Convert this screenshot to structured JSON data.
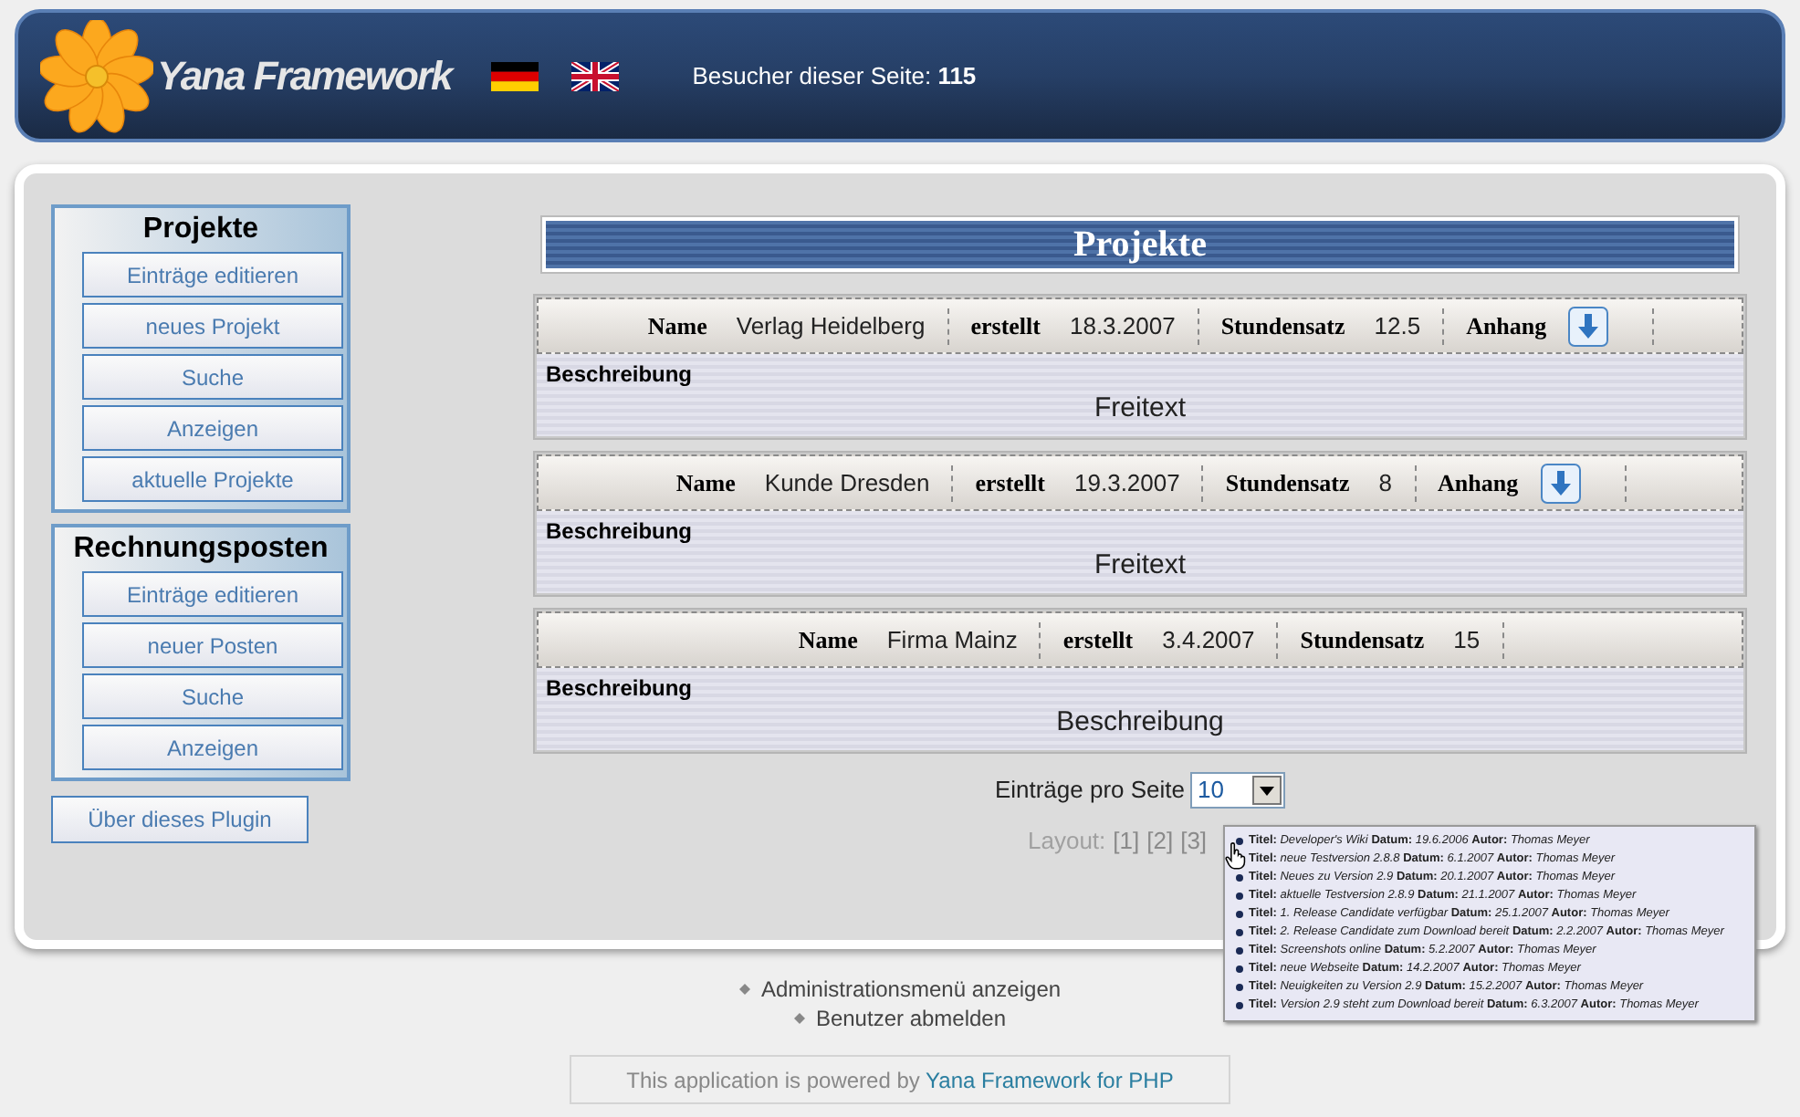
{
  "header": {
    "logo": "Yana Framework",
    "visitors_label": "Besucher dieser Seite:",
    "visitors_count": "115"
  },
  "sidebar": [
    {
      "title": "Projekte",
      "items": [
        "Einträge editieren",
        "neues Projekt",
        "Suche",
        "Anzeigen",
        "aktuelle Projekte"
      ]
    },
    {
      "title": "Rechnungsposten",
      "items": [
        "Einträge editieren",
        "neuer Posten",
        "Suche",
        "Anzeigen"
      ]
    }
  ],
  "plugin_button": "Über dieses Plugin",
  "content": {
    "title": "Projekte",
    "records": [
      {
        "fields": [
          {
            "kind": "text",
            "label": "Name",
            "value": "Verlag Heidelberg"
          },
          {
            "kind": "text",
            "label": "erstellt",
            "value": "18.3.2007"
          },
          {
            "kind": "text",
            "label": "Stundensatz",
            "value": "12.5"
          },
          {
            "kind": "attachment",
            "label": "Anhang"
          }
        ],
        "description_label": "Beschreibung",
        "description": "Freitext"
      },
      {
        "fields": [
          {
            "kind": "text",
            "label": "Name",
            "value": "Kunde Dresden"
          },
          {
            "kind": "text",
            "label": "erstellt",
            "value": "19.3.2007"
          },
          {
            "kind": "text",
            "label": "Stundensatz",
            "value": "8"
          },
          {
            "kind": "attachment",
            "label": "Anhang"
          }
        ],
        "description_label": "Beschreibung",
        "description": "Freitext"
      },
      {
        "fields": [
          {
            "kind": "text",
            "label": "Name",
            "value": "Firma Mainz"
          },
          {
            "kind": "text",
            "label": "erstellt",
            "value": "3.4.2007"
          },
          {
            "kind": "text",
            "label": "Stundensatz",
            "value": "15"
          }
        ],
        "description_label": "Beschreibung",
        "description": "Beschreibung"
      }
    ],
    "per_page_label": "Einträge pro Seite",
    "per_page_value": "10",
    "layout_label": "Layout:",
    "layouts": [
      "[1]",
      "[2]",
      "[3]"
    ]
  },
  "tooltip": {
    "items": [
      "**Titel:** *Developer's Wiki* **Datum:** *19.6.2006* **Autor:** *Thomas Meyer*",
      "**Titel:** *neue Testversion 2.8.8* **Datum:** *6.1.2007* **Autor:** *Thomas Meyer*",
      "**Titel:** *Neues zu Version 2.9* **Datum:** *20.1.2007* **Autor:** *Thomas Meyer*",
      "**Titel:** *aktuelle Testversion 2.8.9* **Datum:** *21.1.2007* **Autor:** *Thomas Meyer*",
      "**Titel:** *1. Release Candidate verfügbar* **Datum:** *25.1.2007* **Autor:** *Thomas Meyer*",
      "**Titel:** *2. Release Candidate zum Download bereit* **Datum:** *2.2.2007* **Autor:** *Thomas Meyer*",
      "**Titel:** *Screenshots online* **Datum:** *5.2.2007* **Autor:** *Thomas Meyer*",
      "**Titel:** *neue Webseite* **Datum:** *14.2.2007* **Autor:** *Thomas Meyer*",
      "**Titel:** *Neuigkeiten zu Version 2.9* **Datum:** *15.2.2007* **Autor:** *Thomas Meyer*",
      "**Titel:** *Version 2.9 steht zum Download bereit* **Datum:** *6.3.2007* **Autor:** *Thomas Meyer*"
    ]
  },
  "footer": {
    "links": [
      "Administrationsmenü anzeigen",
      "Benutzer abmelden"
    ],
    "powered_text": "This application is powered by",
    "powered_link": "Yana Framework for PHP"
  }
}
